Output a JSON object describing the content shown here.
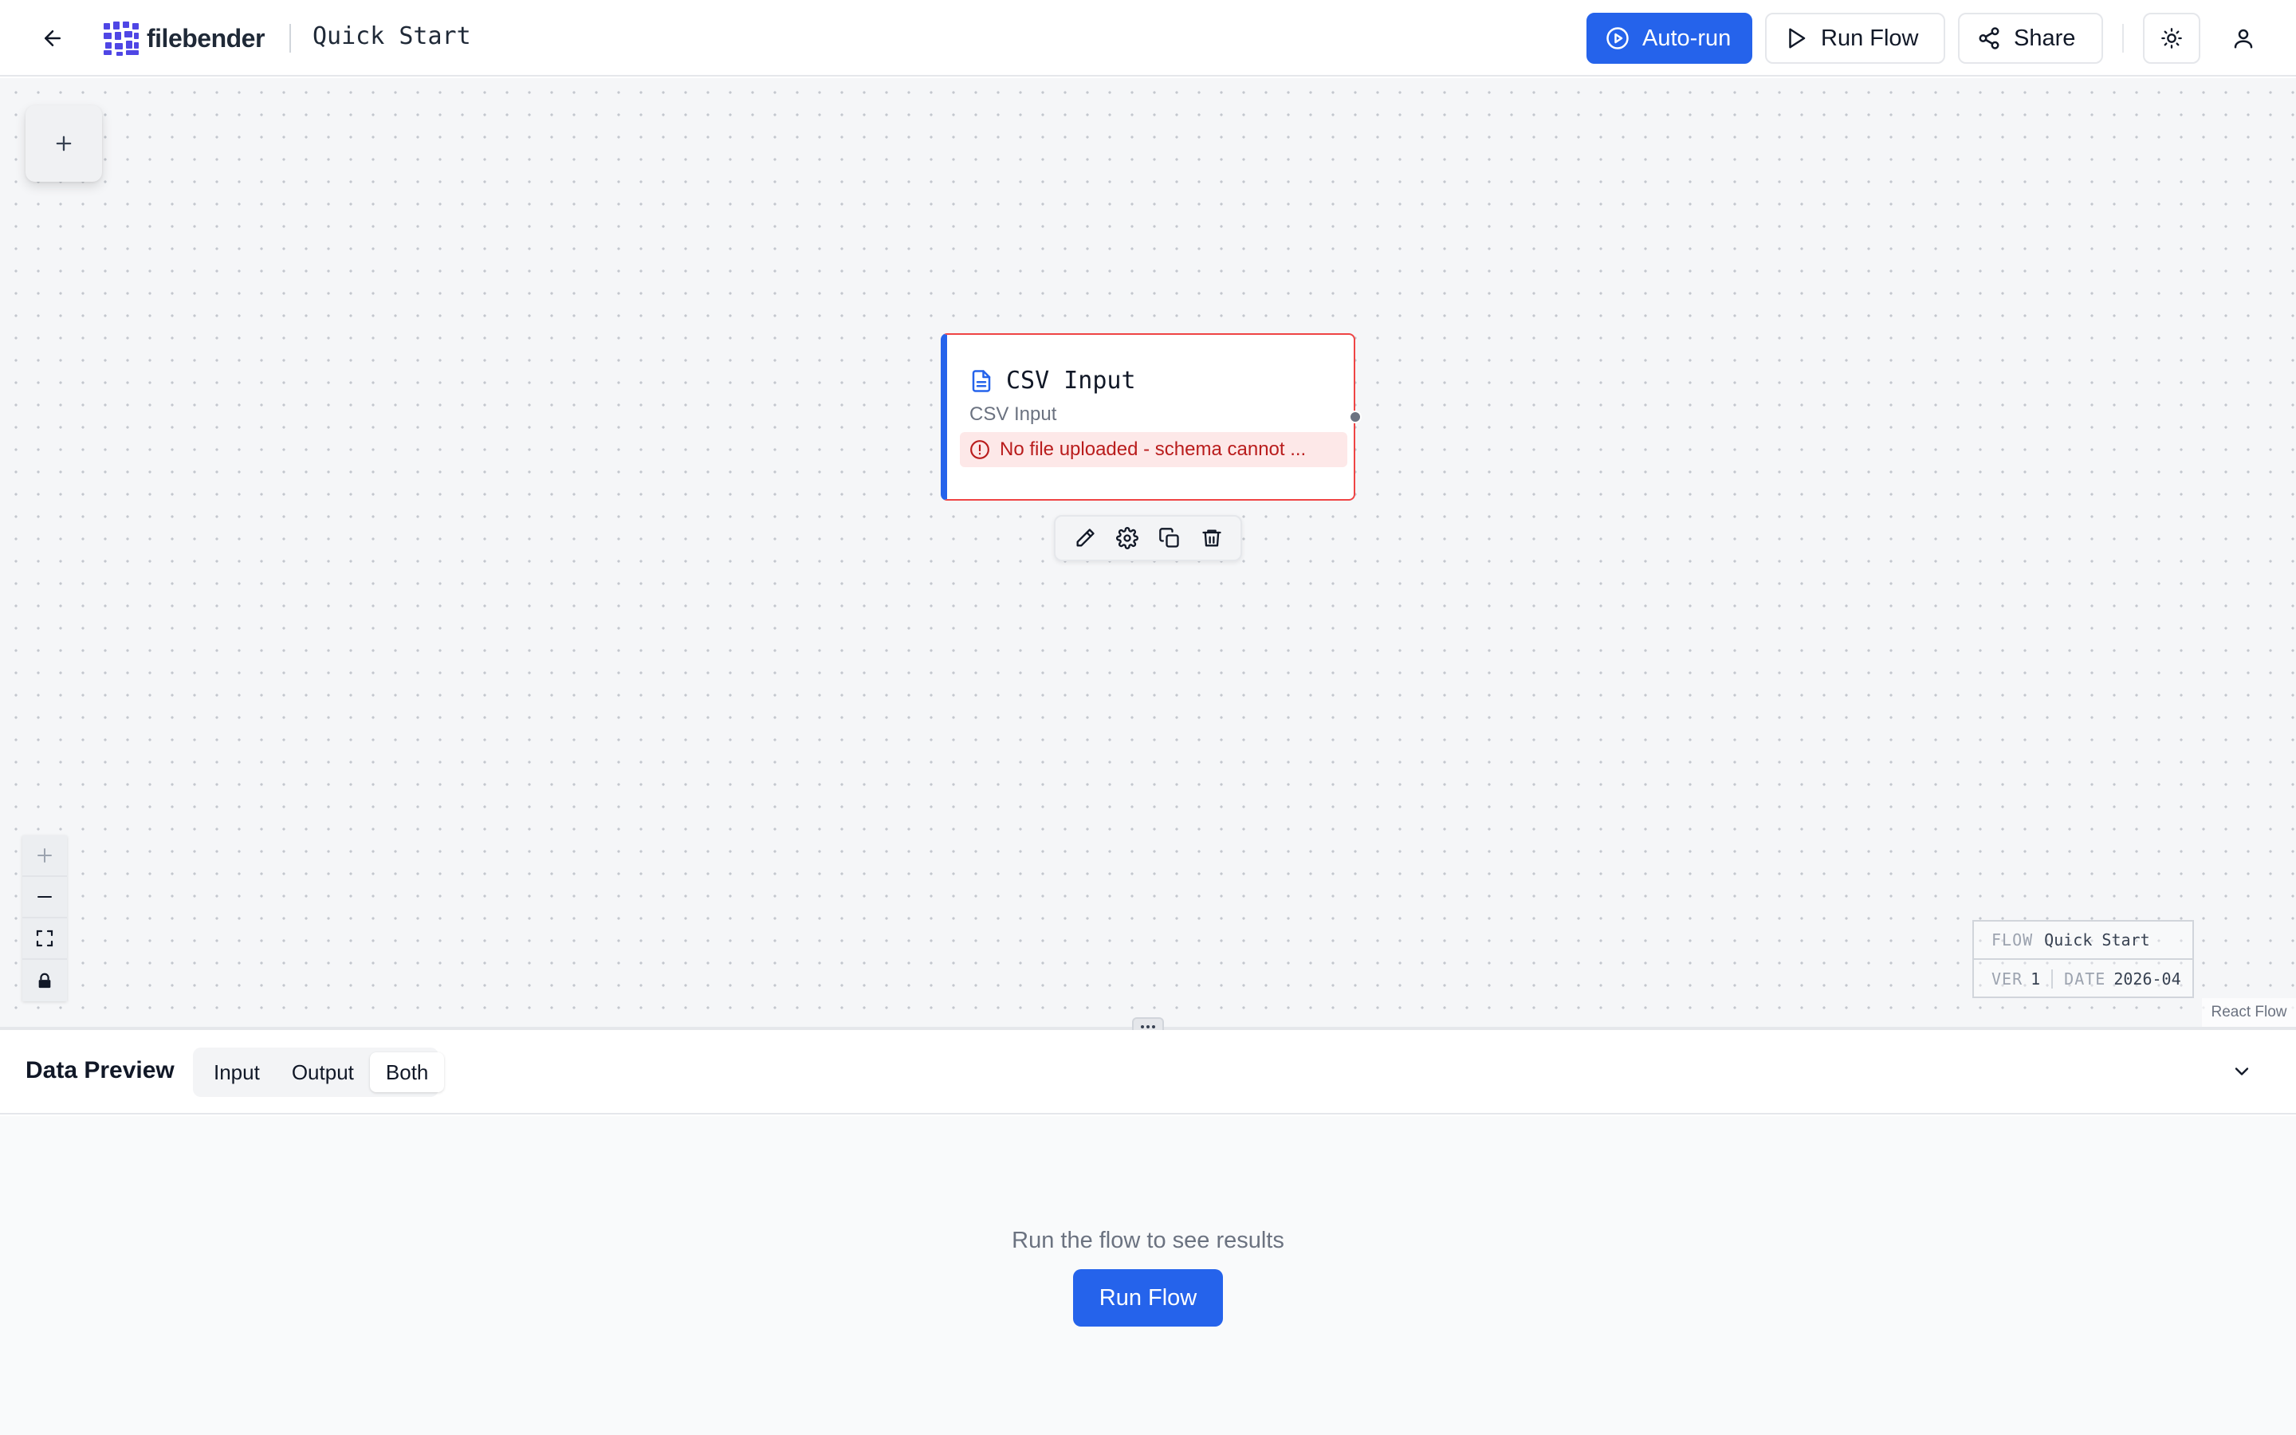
{
  "header": {
    "app_name": "filebender",
    "flow_title": "Quick Start",
    "autorun_label": "Auto-run",
    "run_label": "Run Flow",
    "share_label": "Share"
  },
  "node": {
    "title": "CSV Input",
    "subtitle": "CSV Input",
    "error": "No file uploaded - schema cannot ..."
  },
  "title_block": {
    "flow_key": "FLOW",
    "flow_value": "Quick Start",
    "ver_key": "VER",
    "ver_value": "1",
    "date_key": "DATE",
    "date_value": "2026-04"
  },
  "attribution": "React Flow",
  "preview": {
    "title": "Data Preview",
    "tabs": [
      "Input",
      "Output",
      "Both"
    ],
    "active_tab": "Both",
    "empty_message": "Run the flow to see results",
    "run_label": "Run Flow"
  },
  "colors": {
    "primary": "#2563eb",
    "error": "#ef4444",
    "error_bg": "#fde8e8"
  },
  "icons": [
    "arrow-left-icon",
    "play-circle-icon",
    "play-icon",
    "share-icon",
    "sun-icon",
    "user-icon",
    "plus-icon",
    "file-text-icon",
    "alert-circle-icon",
    "pencil-icon",
    "gear-icon",
    "copy-icon",
    "trash-icon",
    "minus-icon",
    "fit-view-icon",
    "lock-icon",
    "chevron-down-icon",
    "grip-icon"
  ]
}
